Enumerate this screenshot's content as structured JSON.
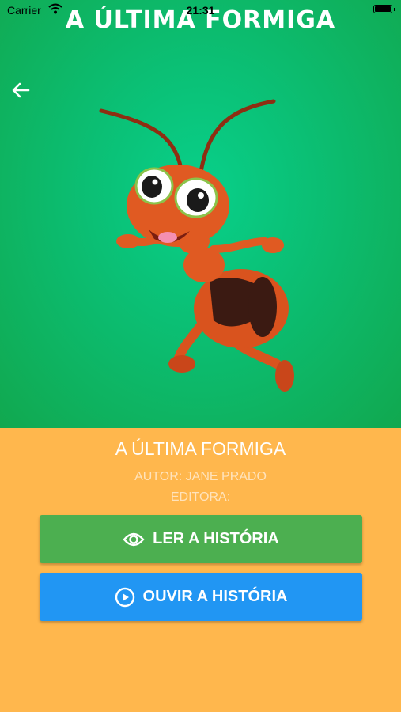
{
  "status": {
    "carrier": "Carrier",
    "time": "21:31"
  },
  "hero": {
    "title": "A ÚLTIMA FORMIGA"
  },
  "book": {
    "title": "A ÚLTIMA FORMIGA",
    "author": "AUTOR: JANE PRADO",
    "publisher": "EDITORA:"
  },
  "actions": {
    "read_label": "LER A HISTÓRIA",
    "listen_label": "OUVIR A HISTÓRIA"
  },
  "icons": {
    "back": "arrow-left-icon",
    "read": "eye-icon",
    "listen": "play-circle-icon"
  },
  "colors": {
    "hero_green": "#0BBF74",
    "background_orange": "#FFB74D",
    "read_button": "#4CAF50",
    "listen_button": "#2196F3"
  }
}
